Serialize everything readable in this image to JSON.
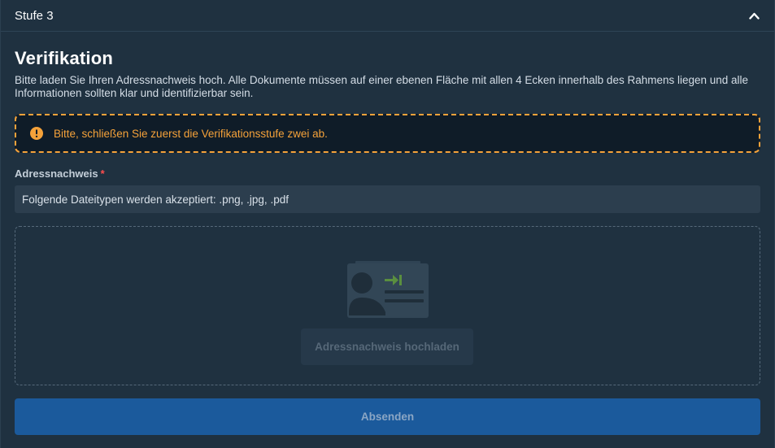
{
  "header": {
    "title": "Stufe 3",
    "toggle_icon": "chevron-up-icon"
  },
  "section": {
    "title": "Verifikation",
    "description": "Bitte laden Sie Ihren Adressnachweis hoch. Alle Dokumente müssen auf einer ebenen Fläche mit allen 4 Ecken innerhalb des Rahmens liegen und alle Informationen sollten klar und identifizierbar sein."
  },
  "alert": {
    "icon": "warning-icon",
    "text": "Bitte, schließen Sie zuerst die Verifikationsstufe zwei ab.",
    "color": "#f5a23a"
  },
  "field": {
    "label": "Adressnachweis",
    "required_mark": "*",
    "accepted_types": "Folgende Dateitypen werden akzeptiert: .png, .jpg, .pdf"
  },
  "dropzone": {
    "illustration": "id-card-icon",
    "upload_label": "Adressnachweis hochladen"
  },
  "submit": {
    "label": "Absenden",
    "color": "#1b5a9c"
  }
}
